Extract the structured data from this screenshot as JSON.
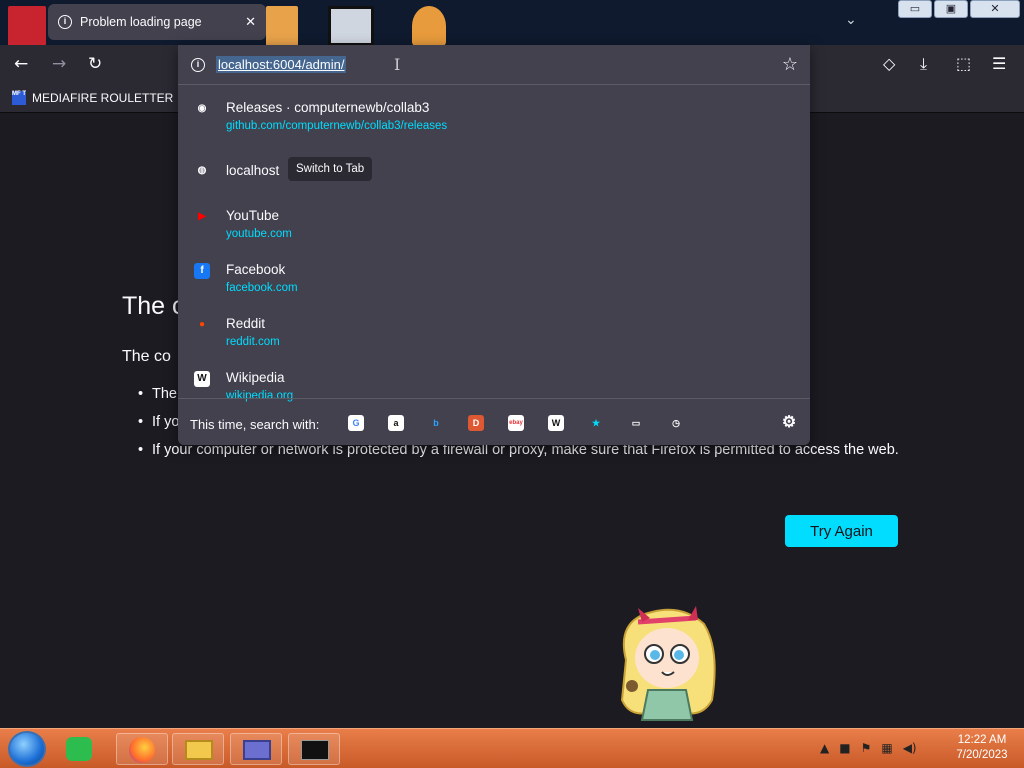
{
  "tab": {
    "title": "Problem loading page",
    "close": "✕"
  },
  "window_controls": {
    "minimize": "▭",
    "maximize": "▣",
    "close": "✕"
  },
  "navbar": {
    "back": "←",
    "forward": "→",
    "reload": "↻",
    "tab_list": "⌄"
  },
  "bookmarks": [
    {
      "label": "MEDIAFIRE ROULETTER",
      "icon_text": "MF T"
    }
  ],
  "urlbar": {
    "value": "localhost:6004/admin/",
    "results": [
      {
        "title": "Releases · computernewb/collab3",
        "url": "github.com/computernewb/collab3/releases",
        "icon": "github-icon",
        "glyph": "◉"
      },
      {
        "title": "localhost",
        "url": "",
        "badge": "Switch to Tab",
        "icon": "globe-icon",
        "glyph": "◍"
      },
      {
        "title": "YouTube",
        "url": "youtube.com",
        "icon": "youtube-icon",
        "glyph": "▶"
      },
      {
        "title": "Facebook",
        "url": "facebook.com",
        "icon": "facebook-icon",
        "glyph": "f"
      },
      {
        "title": "Reddit",
        "url": "reddit.com",
        "icon": "reddit-icon",
        "glyph": "●"
      },
      {
        "title": "Wikipedia",
        "url": "wikipedia.org",
        "icon": "wikipedia-icon",
        "glyph": "W"
      }
    ],
    "search_label": "This time, search with:",
    "engines": [
      {
        "name": "google-icon",
        "glyph": "G",
        "color": "#ffffff",
        "fg": "#4285f4"
      },
      {
        "name": "amazon-icon",
        "glyph": "a",
        "color": "#ffffff",
        "fg": "#111111"
      },
      {
        "name": "bing-icon",
        "glyph": "b",
        "color": "#42414d",
        "fg": "#2aa3ff"
      },
      {
        "name": "duckduckgo-icon",
        "glyph": "D",
        "color": "#de5833",
        "fg": "#ffffff"
      },
      {
        "name": "ebay-icon",
        "glyph": "ebay",
        "color": "#ffffff",
        "fg": "#e53238"
      },
      {
        "name": "wikipedia-icon",
        "glyph": "W",
        "color": "#ffffff",
        "fg": "#111111"
      },
      {
        "name": "bookmarks-icon",
        "glyph": "★",
        "color": "#42414d",
        "fg": "#00ddff"
      },
      {
        "name": "tabs-icon",
        "glyph": "▭",
        "color": "#42414d",
        "fg": "#fbfbfe"
      },
      {
        "name": "history-icon",
        "glyph": "◷",
        "color": "#42414d",
        "fg": "#fbfbfe"
      }
    ],
    "settings_glyph": "⚙"
  },
  "toolbar_right": {
    "pocket": "◇",
    "downloads": "⤓",
    "extensions": "⬚",
    "menu": "☰"
  },
  "error": {
    "title": "The c",
    "intro": "The co",
    "items": [
      "The",
      "If yo",
      "If your computer or network is protected by a firewall or proxy, make sure that Firefox is permitted to access the web."
    ],
    "button": "Try Again"
  },
  "taskbar": {
    "time": "12:22 AM",
    "date": "7/20/2023"
  },
  "colors": {
    "accent": "#00ddff",
    "panel": "#42414d",
    "page": "#1c1b22",
    "taskbar": "#d96a36"
  }
}
